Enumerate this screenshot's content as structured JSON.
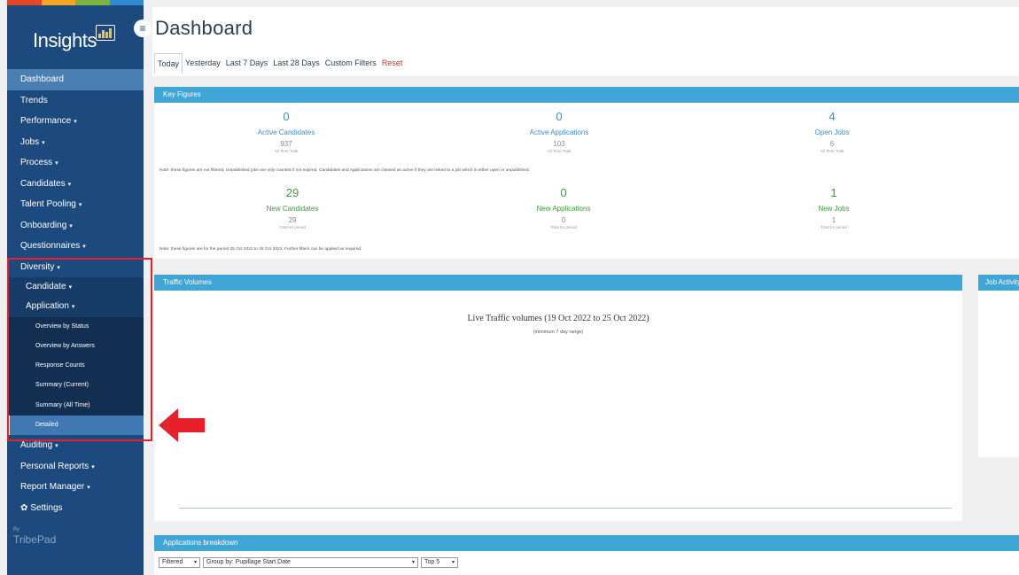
{
  "brand_stripe": [
    "#e8462b",
    "#f5a623",
    "#7cb342",
    "#2e8bd0"
  ],
  "logo": {
    "text": "Insights"
  },
  "sidebar": {
    "items": [
      {
        "label": "Dashboard"
      },
      {
        "label": "Trends"
      },
      {
        "label": "Performance",
        "caret": "▾"
      },
      {
        "label": "Jobs",
        "caret": "▾"
      },
      {
        "label": "Process",
        "caret": "▾"
      },
      {
        "label": "Candidates",
        "caret": "▾"
      },
      {
        "label": "Talent Pooling",
        "caret": "▾"
      },
      {
        "label": "Onboarding",
        "caret": "▾"
      },
      {
        "label": "Questionnaires",
        "caret": "▾"
      },
      {
        "label": "Diversity",
        "caret": "▾"
      }
    ],
    "diversity_sub": [
      {
        "label": "Candidate",
        "caret": "▾"
      },
      {
        "label": "Application",
        "caret": "▾"
      }
    ],
    "application_sub": [
      {
        "label": "Overview by Status"
      },
      {
        "label": "Overview by Answers"
      },
      {
        "label": "Response Counts"
      },
      {
        "label": "Summary (Current)"
      },
      {
        "label": "Summary (All Time)"
      },
      {
        "label": "Detailed"
      }
    ],
    "bottom_items": [
      {
        "label": "Auditing",
        "caret": "▾"
      },
      {
        "label": "Personal Reports",
        "caret": "▾"
      },
      {
        "label": "Report Manager",
        "caret": "▾"
      },
      {
        "label": "Settings",
        "icon": "gear-icon"
      }
    ],
    "by": "By",
    "brand": "TribePad"
  },
  "header": {
    "title": "Dashboard",
    "menu_icon": "≡",
    "tabs": [
      "Today",
      "Yesterday",
      "Last 7 Days",
      "Last 28 Days",
      "Custom Filters",
      "Reset"
    ]
  },
  "key_figures": {
    "title": "Key Figures",
    "row1": [
      {
        "value": "0",
        "label": "Active Candidates",
        "total": "937",
        "total_label": "All Time Total"
      },
      {
        "value": "0",
        "label": "Active Applications",
        "total": "103",
        "total_label": "All Time Total"
      },
      {
        "value": "4",
        "label": "Open Jobs",
        "total": "6",
        "total_label": "All Time Total"
      }
    ],
    "note1": "Note: these figures are not filtered. Unpublished jobs are only counted if not expired. Candidates and Applications are classed as active if they are linked to a job which is either open or unpublished.",
    "row2": [
      {
        "value": "29",
        "label": "New Candidates",
        "total": "29",
        "total_label": "Total for period"
      },
      {
        "value": "0",
        "label": "New Applications",
        "total": "0",
        "total_label": "Total for period"
      },
      {
        "value": "1",
        "label": "New Jobs",
        "total": "1",
        "total_label": "Total for period"
      }
    ],
    "note2": "Note: these figures are for the period 25 Oct 2022 to 26 Oct 2022. Further filters can be applied as required."
  },
  "traffic": {
    "title": "Traffic Volumes",
    "chart_title": "Live Traffic volumes (19 Oct 2022 to 25 Oct 2022)",
    "chart_subtitle": "(minimum 7 day range)"
  },
  "job_activity": {
    "title": "Job Activity"
  },
  "applications": {
    "title": "Applications breakdown",
    "filter1": "Filtered",
    "filter2": "Group by: Pupillage Start Date",
    "filter3": "Top 5"
  }
}
